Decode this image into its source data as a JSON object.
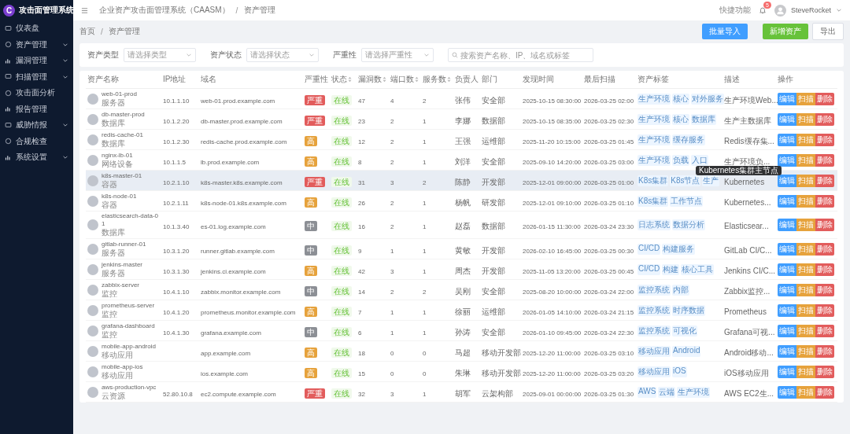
{
  "app": {
    "title": "攻击面管理系统",
    "logo": "C"
  },
  "sidebar": {
    "items": [
      {
        "label": "仪表盘",
        "expandable": false
      },
      {
        "label": "资产管理",
        "expandable": true
      },
      {
        "label": "漏洞管理",
        "expandable": true
      },
      {
        "label": "扫描管理",
        "expandable": true
      },
      {
        "label": "攻击面分析",
        "expandable": false
      },
      {
        "label": "报告管理",
        "expandable": false
      },
      {
        "label": "威胁情报",
        "expandable": true
      },
      {
        "label": "合规检查",
        "expandable": false
      },
      {
        "label": "系统设置",
        "expandable": true
      }
    ]
  },
  "header": {
    "breadcrumb": [
      "企业资产攻击面管理系统（CAASM）",
      "资产管理"
    ],
    "breadcrumb_separator": "/",
    "quick_action": "快捷功能",
    "notification_count": "5",
    "user": "SteveRocket"
  },
  "page": {
    "breadcrumb": [
      "首页",
      "资产管理"
    ],
    "breadcrumb_separator": "/",
    "buttons": [
      {
        "label": "批量导入",
        "kind": "import"
      },
      {
        "label": "新增资产",
        "kind": "add"
      },
      {
        "label": "导出",
        "kind": "export"
      }
    ]
  },
  "filters": [
    {
      "label": "资产类型",
      "placeholder": "请选择类型"
    },
    {
      "label": "资产状态",
      "placeholder": "请选择状态"
    },
    {
      "label": "严重性",
      "placeholder": "请选择严重性"
    }
  ],
  "search": {
    "placeholder": "搜索资产名称、IP、域名或标签"
  },
  "table": {
    "columns": [
      {
        "label": "资产名称",
        "sortable": false
      },
      {
        "label": "IP地址",
        "sortable": false
      },
      {
        "label": "域名",
        "sortable": false
      },
      {
        "label": "严重性",
        "sortable": false
      },
      {
        "label": "状态",
        "sortable": true
      },
      {
        "label": "漏洞数",
        "sortable": true
      },
      {
        "label": "端口数",
        "sortable": true
      },
      {
        "label": "服务数",
        "sortable": true
      },
      {
        "label": "负责人",
        "sortable": false
      },
      {
        "label": "部门",
        "sortable": false
      },
      {
        "label": "发现时间",
        "sortable": false
      },
      {
        "label": "最后扫描",
        "sortable": false
      },
      {
        "label": "资产标签",
        "sortable": false
      },
      {
        "label": "描述",
        "sortable": false
      },
      {
        "label": "操作",
        "sortable": false
      }
    ],
    "rows": [
      {
        "name": "web-01-prod",
        "type": "服务器",
        "ip": "10.1.1.10",
        "domain": "web-01.prod.example.com",
        "severity": "严重",
        "color": "#e25c5c",
        "status": "在线",
        "vulns": "47",
        "ports": "4",
        "services": "2",
        "owner": "张伟",
        "dept": "安全部",
        "found": "2025-10-15 08:30:00",
        "scanned": "2026-03-25 02:00",
        "tags": [
          "生产环境",
          "核心",
          "对外服务"
        ],
        "desc": "生产环境Web...",
        "highlighted": false,
        "actions": [
          "编辑",
          "扫描",
          "删除"
        ]
      },
      {
        "name": "db-master-prod",
        "type": "数据库",
        "ip": "10.1.2.20",
        "domain": "db-master.prod.example.com",
        "severity": "严重",
        "color": "#e25c5c",
        "status": "在线",
        "vulns": "23",
        "ports": "2",
        "services": "1",
        "owner": "李娜",
        "dept": "数据部",
        "found": "2025-10-15 08:35:00",
        "scanned": "2026-03-25 02:30",
        "tags": [
          "生产环境",
          "核心",
          "数据库"
        ],
        "desc": "生产主数据库",
        "highlighted": false,
        "actions": [
          "编辑",
          "扫描",
          "删除"
        ]
      },
      {
        "name": "redis-cache-01",
        "type": "数据库",
        "ip": "10.1.2.30",
        "domain": "redis-cache.prod.example.com",
        "severity": "高",
        "color": "#e6a23c",
        "status": "在线",
        "vulns": "12",
        "ports": "2",
        "services": "1",
        "owner": "王强",
        "dept": "运维部",
        "found": "2025-11-20 10:15:00",
        "scanned": "2026-03-25 01:45",
        "tags": [
          "生产环境",
          "缓存服务"
        ],
        "desc": "Redis缓存集...",
        "highlighted": false,
        "actions": [
          "编辑",
          "扫描",
          "删除"
        ]
      },
      {
        "name": "nginx-lb-01",
        "type": "网络设备",
        "ip": "10.1.1.5",
        "domain": "lb.prod.example.com",
        "severity": "高",
        "color": "#e6a23c",
        "status": "在线",
        "vulns": "8",
        "ports": "2",
        "services": "1",
        "owner": "刘洋",
        "dept": "安全部",
        "found": "2025-09-10 14:20:00",
        "scanned": "2026-03-25 03:00",
        "tags": [
          "生产环境",
          "负载",
          "入口"
        ],
        "desc": "生产环境负...",
        "highlighted": false,
        "actions": [
          "编辑",
          "扫描",
          "删除"
        ]
      },
      {
        "name": "k8s-master-01",
        "type": "容器",
        "ip": "10.2.1.10",
        "domain": "k8s-master.k8s.example.com",
        "severity": "严重",
        "color": "#e25c5c",
        "status": "在线",
        "vulns": "31",
        "ports": "3",
        "services": "2",
        "owner": "陈静",
        "dept": "开发部",
        "found": "2025-12-01 09:00:00",
        "scanned": "2026-03-25 01:00",
        "tags": [
          "K8s集群",
          "K8s节点",
          "生产"
        ],
        "desc": "Kubernetes",
        "highlighted": true,
        "tooltip": "Kubernetes集群主节点",
        "actions": [
          "编辑",
          "扫描",
          "删除"
        ]
      },
      {
        "name": "k8s-node-01",
        "type": "容器",
        "ip": "10.2.1.11",
        "domain": "k8s-node-01.k8s.example.com",
        "severity": "高",
        "color": "#e6a23c",
        "status": "在线",
        "vulns": "26",
        "ports": "2",
        "services": "1",
        "owner": "杨帆",
        "dept": "研发部",
        "found": "2025-12-01 09:10:00",
        "scanned": "2026-03-25 01:10",
        "tags": [
          "K8s集群",
          "工作节点"
        ],
        "desc": "Kubernetes...",
        "highlighted": false,
        "actions": [
          "编辑",
          "扫描",
          "删除"
        ]
      },
      {
        "name": "elasticsearch-data-01",
        "type": "数据库",
        "ip": "10.1.3.40",
        "domain": "es-01.log.example.com",
        "severity": "中",
        "color": "#8c8f95",
        "status": "在线",
        "vulns": "16",
        "ports": "2",
        "services": "1",
        "owner": "赵磊",
        "dept": "数据部",
        "found": "2026-01-15 11:30:00",
        "scanned": "2026-03-24 23:30",
        "tags": [
          "日志系统",
          "数据分析"
        ],
        "desc": "Elasticsear...",
        "highlighted": false,
        "actions": [
          "编辑",
          "扫描",
          "删除"
        ]
      },
      {
        "name": "gitlab-runner-01",
        "type": "服务器",
        "ip": "10.3.1.20",
        "domain": "runner.gitlab.example.com",
        "severity": "中",
        "color": "#8c8f95",
        "status": "在线",
        "vulns": "9",
        "ports": "1",
        "services": "1",
        "owner": "黄敏",
        "dept": "开发部",
        "found": "2026-02-10 16:45:00",
        "scanned": "2026-03-25 00:30",
        "tags": [
          "CI/CD",
          "构建服务"
        ],
        "desc": "GitLab CI/C...",
        "highlighted": false,
        "actions": [
          "编辑",
          "扫描",
          "删除"
        ]
      },
      {
        "name": "jenkins-master",
        "type": "服务器",
        "ip": "10.3.1.30",
        "domain": "jenkins.ci.example.com",
        "severity": "高",
        "color": "#e6a23c",
        "status": "在线",
        "vulns": "42",
        "ports": "3",
        "services": "1",
        "owner": "周杰",
        "dept": "开发部",
        "found": "2025-11-05 13:20:00",
        "scanned": "2026-03-25 00:45",
        "tags": [
          "CI/CD",
          "构建",
          "核心工具"
        ],
        "desc": "Jenkins CI/C...",
        "highlighted": false,
        "actions": [
          "编辑",
          "扫描",
          "删除"
        ]
      },
      {
        "name": "zabbix-server",
        "type": "监控",
        "ip": "10.4.1.10",
        "domain": "zabbix.monitor.example.com",
        "severity": "中",
        "color": "#8c8f95",
        "status": "在线",
        "vulns": "14",
        "ports": "2",
        "services": "2",
        "owner": "吴刚",
        "dept": "安全部",
        "found": "2025-08-20 10:00:00",
        "scanned": "2026-03-24 22:00",
        "tags": [
          "监控系统",
          "内部"
        ],
        "desc": "Zabbix监控...",
        "highlighted": false,
        "actions": [
          "编辑",
          "扫描",
          "删除"
        ]
      },
      {
        "name": "prometheus-server",
        "type": "监控",
        "ip": "10.4.1.20",
        "domain": "prometheus.monitor.example.com",
        "severity": "高",
        "color": "#e6a23c",
        "status": "在线",
        "vulns": "7",
        "ports": "1",
        "services": "1",
        "owner": "徐丽",
        "dept": "运维部",
        "found": "2026-01-05 14:10:00",
        "scanned": "2026-03-24 21:15",
        "tags": [
          "监控系统",
          "时序数据"
        ],
        "desc": "Prometheus",
        "highlighted": false,
        "actions": [
          "编辑",
          "扫描",
          "删除"
        ]
      },
      {
        "name": "grafana-dashboard",
        "type": "监控",
        "ip": "10.4.1.30",
        "domain": "grafana.example.com",
        "severity": "中",
        "color": "#8c8f95",
        "status": "在线",
        "vulns": "6",
        "ports": "1",
        "services": "1",
        "owner": "孙涛",
        "dept": "安全部",
        "found": "2026-01-10 09:45:00",
        "scanned": "2026-03-24 22:30",
        "tags": [
          "监控系统",
          "可视化"
        ],
        "desc": "Grafana可视...",
        "highlighted": false,
        "actions": [
          "编辑",
          "扫描",
          "删除"
        ]
      },
      {
        "name": "mobile-app-android",
        "type": "移动应用",
        "domain": "app.example.com",
        "severity": "高",
        "color": "#e6a23c",
        "status": "在线",
        "vulns": "18",
        "ports": "0",
        "services": "0",
        "owner": "马超",
        "dept": "移动开发部",
        "found": "2025-12-20 11:00:00",
        "scanned": "2026-03-25 03:10",
        "tags": [
          "移动应用",
          "Android"
        ],
        "desc": "Android移动...",
        "highlighted": false,
        "actions": [
          "编辑",
          "扫描",
          "删除"
        ]
      },
      {
        "name": "mobile-app-ios",
        "type": "移动应用",
        "domain": "ios.example.com",
        "severity": "高",
        "color": "#e6a23c",
        "status": "在线",
        "vulns": "15",
        "ports": "0",
        "services": "0",
        "owner": "朱琳",
        "dept": "移动开发部",
        "found": "2025-12-20 11:00:00",
        "scanned": "2026-03-25 03:20",
        "tags": [
          "移动应用",
          "iOS"
        ],
        "desc": "iOS移动应用",
        "highlighted": false,
        "actions": [
          "编辑",
          "扫描",
          "删除"
        ]
      },
      {
        "name": "aws-production-vpc",
        "type": "云资源",
        "ip": "52.80.10.8",
        "domain": "ec2.compute.example.com",
        "severity": "严重",
        "color": "#e25c5c",
        "status": "在线",
        "vulns": "32",
        "ports": "3",
        "services": "1",
        "owner": "胡军",
        "dept": "云架构部",
        "found": "2025-09-01 00:00:00",
        "scanned": "2026-03-25 01:30",
        "tags": [
          "AWS",
          "云端",
          "生产环境"
        ],
        "desc": "AWS EC2生...",
        "highlighted": false,
        "actions": [
          "编辑",
          "扫描",
          "删除"
        ]
      }
    ]
  }
}
